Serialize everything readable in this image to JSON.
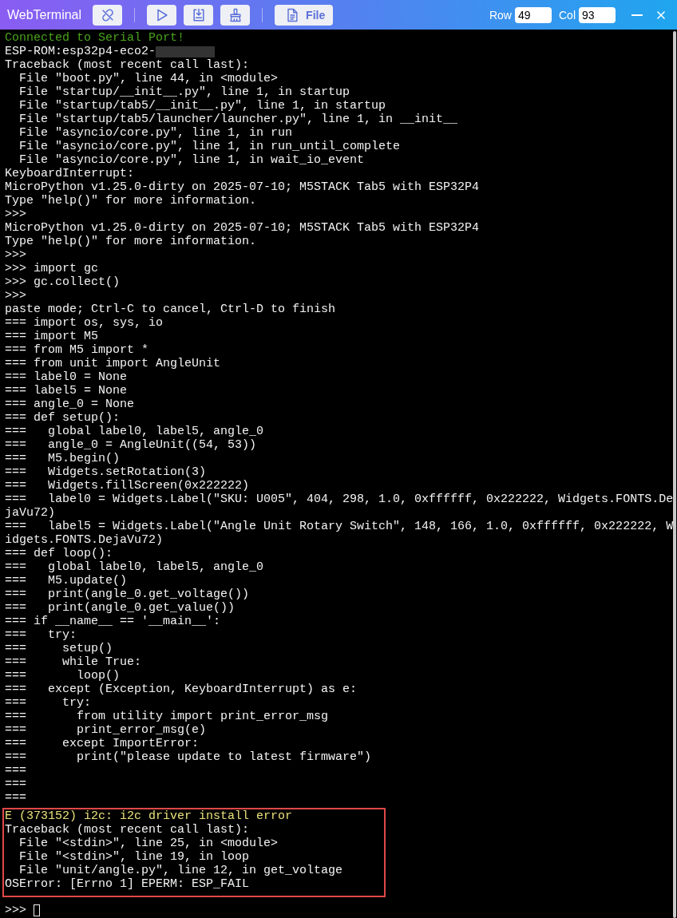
{
  "window": {
    "title": "WebTerminal"
  },
  "toolbar": {
    "buttons": [
      {
        "kind": "disconnect"
      },
      {
        "kind": "separator"
      },
      {
        "kind": "run"
      },
      {
        "kind": "download"
      },
      {
        "kind": "clear"
      },
      {
        "kind": "separator"
      },
      {
        "kind": "file",
        "label": "File"
      }
    ],
    "row": {
      "label": "Row",
      "value": "49"
    },
    "col": {
      "label": "Col",
      "value": "93"
    }
  },
  "terminal": {
    "lines": [
      {
        "text": "Connected to Serial Port!",
        "kind": "info"
      },
      {
        "text": "ESP-ROM:esp32p4-eco2-",
        "kind": "normal",
        "redacted": true
      },
      {
        "text": "Traceback (most recent call last):",
        "kind": "normal"
      },
      {
        "text": "  File \"boot.py\", line 44, in <module>",
        "kind": "normal"
      },
      {
        "text": "  File \"startup/__init__.py\", line 1, in startup",
        "kind": "normal"
      },
      {
        "text": "  File \"startup/tab5/__init__.py\", line 1, in startup",
        "kind": "normal"
      },
      {
        "text": "  File \"startup/tab5/launcher/launcher.py\", line 1, in __init__",
        "kind": "normal"
      },
      {
        "text": "  File \"asyncio/core.py\", line 1, in run",
        "kind": "normal"
      },
      {
        "text": "  File \"asyncio/core.py\", line 1, in run_until_complete",
        "kind": "normal"
      },
      {
        "text": "  File \"asyncio/core.py\", line 1, in wait_io_event",
        "kind": "normal"
      },
      {
        "text": "KeyboardInterrupt:",
        "kind": "normal"
      },
      {
        "text": "MicroPython v1.25.0-dirty on 2025-07-10; M5STACK Tab5 with ESP32P4",
        "kind": "normal"
      },
      {
        "text": "Type \"help()\" for more information.",
        "kind": "normal"
      },
      {
        "text": ">>>",
        "kind": "normal"
      },
      {
        "text": "MicroPython v1.25.0-dirty on 2025-07-10; M5STACK Tab5 with ESP32P4",
        "kind": "normal"
      },
      {
        "text": "Type \"help()\" for more information.",
        "kind": "normal"
      },
      {
        "text": ">>>",
        "kind": "normal"
      },
      {
        "text": ">>> import gc",
        "kind": "normal"
      },
      {
        "text": ">>> gc.collect()",
        "kind": "normal"
      },
      {
        "text": ">>>",
        "kind": "normal"
      },
      {
        "text": "paste mode; Ctrl-C to cancel, Ctrl-D to finish",
        "kind": "normal"
      },
      {
        "text": "=== import os, sys, io",
        "kind": "normal"
      },
      {
        "text": "=== import M5",
        "kind": "normal"
      },
      {
        "text": "=== from M5 import *",
        "kind": "normal"
      },
      {
        "text": "=== from unit import AngleUnit",
        "kind": "normal"
      },
      {
        "text": "=== label0 = None",
        "kind": "normal"
      },
      {
        "text": "=== label5 = None",
        "kind": "normal"
      },
      {
        "text": "=== angle_0 = None",
        "kind": "normal"
      },
      {
        "text": "=== def setup():",
        "kind": "normal"
      },
      {
        "text": "===   global label0, label5, angle_0",
        "kind": "normal"
      },
      {
        "text": "===   angle_0 = AngleUnit((54, 53))",
        "kind": "normal"
      },
      {
        "text": "===   M5.begin()",
        "kind": "normal"
      },
      {
        "text": "===   Widgets.setRotation(3)",
        "kind": "normal"
      },
      {
        "text": "===   Widgets.fillScreen(0x222222)",
        "kind": "normal"
      },
      {
        "text": "===   label0 = Widgets.Label(\"SKU: U005\", 404, 298, 1.0, 0xffffff, 0x222222, Widgets.FONTS.De",
        "kind": "normal"
      },
      {
        "text": "jaVu72)",
        "kind": "normal"
      },
      {
        "text": "===   label5 = Widgets.Label(\"Angle Unit Rotary Switch\", 148, 166, 1.0, 0xffffff, 0x222222, W",
        "kind": "normal"
      },
      {
        "text": "idgets.FONTS.DejaVu72)",
        "kind": "normal"
      },
      {
        "text": "=== def loop():",
        "kind": "normal"
      },
      {
        "text": "===   global label0, label5, angle_0",
        "kind": "normal"
      },
      {
        "text": "===   M5.update()",
        "kind": "normal"
      },
      {
        "text": "===   print(angle_0.get_voltage())",
        "kind": "normal"
      },
      {
        "text": "===   print(angle_0.get_value())",
        "kind": "normal"
      },
      {
        "text": "=== if __name__ == '__main__':",
        "kind": "normal"
      },
      {
        "text": "===   try:",
        "kind": "normal"
      },
      {
        "text": "===     setup()",
        "kind": "normal"
      },
      {
        "text": "===     while True:",
        "kind": "normal"
      },
      {
        "text": "===       loop()",
        "kind": "normal"
      },
      {
        "text": "===   except (Exception, KeyboardInterrupt) as e:",
        "kind": "normal"
      },
      {
        "text": "===     try:",
        "kind": "normal"
      },
      {
        "text": "===       from utility import print_error_msg",
        "kind": "normal"
      },
      {
        "text": "===       print_error_msg(e)",
        "kind": "normal"
      },
      {
        "text": "===     except ImportError:",
        "kind": "normal"
      },
      {
        "text": "===       print(\"please update to latest firmware\")",
        "kind": "normal"
      },
      {
        "text": "===",
        "kind": "normal"
      },
      {
        "text": "===",
        "kind": "normal"
      },
      {
        "text": "===",
        "kind": "normal"
      }
    ],
    "highlighted_lines": [
      {
        "text": "E (373152) i2c: i2c driver install error",
        "kind": "warning"
      },
      {
        "text": "Traceback (most recent call last):",
        "kind": "normal"
      },
      {
        "text": "  File \"<stdin>\", line 25, in <module>",
        "kind": "normal"
      },
      {
        "text": "  File \"<stdin>\", line 19, in loop",
        "kind": "normal"
      },
      {
        "text": "  File \"unit/angle.py\", line 12, in get_voltage",
        "kind": "normal"
      },
      {
        "text": "OSError: [Errno 1] EPERM: ESP_FAIL",
        "kind": "normal"
      }
    ],
    "prompt": ">>>"
  }
}
